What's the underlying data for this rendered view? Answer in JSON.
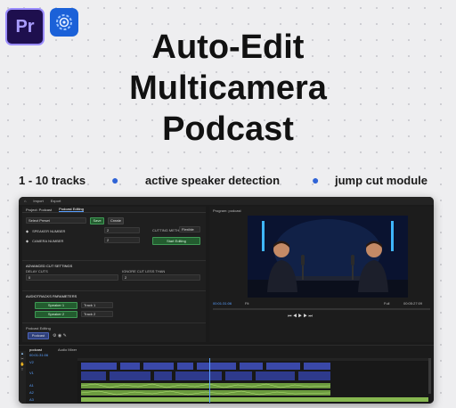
{
  "logos": {
    "premiere_text": "Pr",
    "premiere_icon": "premiere-pro-logo-icon",
    "plugin_icon": "plugin-gear-icon"
  },
  "headline": {
    "line1": "Auto-Edit",
    "line2": "Multicamera",
    "line3": "Podcast"
  },
  "features": [
    "1 - 10 tracks",
    "active speaker detection",
    "jump cut module"
  ],
  "colors": {
    "accent_blue": "#2f63d6",
    "premiere_purple": "#9a8cff",
    "app_background": "#1a1a1a",
    "video_clip": "#2e3a8c",
    "audio_clip": "#5f8f3a"
  },
  "app": {
    "menu": [
      "Import",
      "Export"
    ],
    "panel_tabs": [
      "Project: Podcast",
      "Podcast Editing"
    ],
    "select_preset": "Select Preset",
    "save_label": "Save",
    "create_label": "Create",
    "speaker_number_label": "SPEAKER NUMBER",
    "speaker_number_value": "2",
    "camera_number_label": "CAMERA NUMBER",
    "camera_number_value": "2",
    "cut_method_label": "CUTTING METHOD",
    "cut_method_value": "Flexible",
    "start_editing": "Start Editing",
    "advanced_label": "ADVANCED CUT SETTINGS",
    "delay_cuts_label": "DELAY CUTS",
    "delay_cuts_value": "0",
    "ignore_cuts_label": "IGNORE CUT LESS THAN",
    "ignore_cuts_value": "2",
    "audiotracks_label": "AUDIOTRACKS PARAMETERS",
    "speakers": [
      {
        "name": "Speaker 1",
        "track": "Track 1"
      },
      {
        "name": "Speaker 2",
        "track": "Track 2"
      }
    ],
    "podcast_editing_label": "Podcast Editing",
    "podcast_button": "Podcast",
    "monitor_title": "Program: podcast",
    "monitor_timecode": "00:01:31:06",
    "monitor_fit": "Fit",
    "monitor_full": "Full",
    "monitor_duration": "00:05:27:09",
    "timeline_tabs": [
      "podcast",
      "Audio Mixer"
    ],
    "timeline_timecode": "00:01:31:06",
    "track_labels": [
      "V2",
      "V1",
      "A1",
      "A2",
      "A3"
    ]
  }
}
